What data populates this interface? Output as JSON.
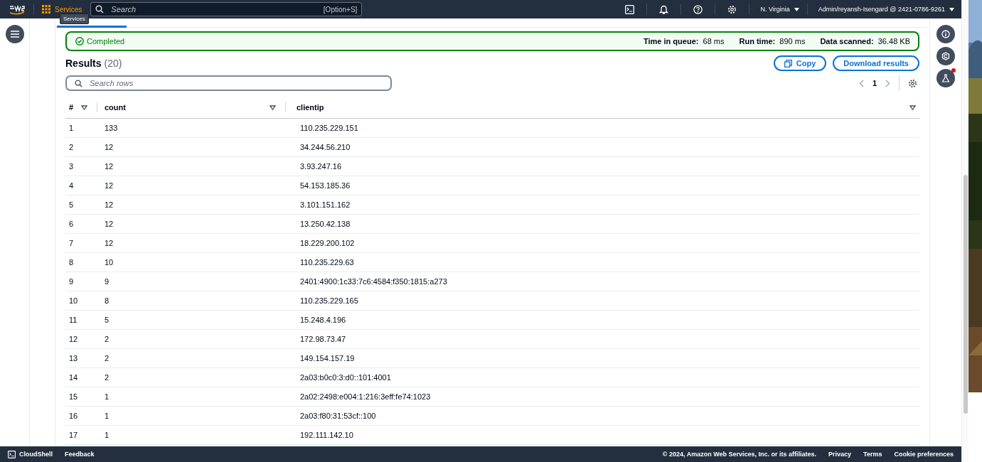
{
  "top_nav": {
    "services_label": "Services",
    "search_placeholder": "Search",
    "search_shortcut": "[Option+S]",
    "region": "N. Virginia",
    "account": "Admin/reyansh-Isengard @ 2421-0786-9261",
    "tooltip": "Services"
  },
  "status": {
    "label": "Completed",
    "metrics": [
      {
        "label": "Time in queue:",
        "value": "68 ms"
      },
      {
        "label": "Run time:",
        "value": "890 ms"
      },
      {
        "label": "Data scanned:",
        "value": "36.48 KB"
      }
    ]
  },
  "results": {
    "title": "Results",
    "count": "(20)",
    "copy_button": "Copy",
    "download_button": "Download results",
    "search_placeholder": "Search rows",
    "page": "1"
  },
  "table": {
    "columns": [
      "#",
      "count",
      "clientip"
    ],
    "rows": [
      [
        "1",
        "133",
        "110.235.229.151"
      ],
      [
        "2",
        "12",
        "34.244.56.210"
      ],
      [
        "3",
        "12",
        "3.93.247.16"
      ],
      [
        "4",
        "12",
        "54.153.185.36"
      ],
      [
        "5",
        "12",
        "3.101.151.162"
      ],
      [
        "6",
        "12",
        "13.250.42.138"
      ],
      [
        "7",
        "12",
        "18.229.200.102"
      ],
      [
        "8",
        "10",
        "110.235.229.63"
      ],
      [
        "9",
        "9",
        "2401:4900:1c33:7c6:4584:f350:1815:a273"
      ],
      [
        "10",
        "8",
        "110.235.229.165"
      ],
      [
        "11",
        "5",
        "15.248.4.196"
      ],
      [
        "12",
        "2",
        "172.98.73.47"
      ],
      [
        "13",
        "2",
        "149.154.157.19"
      ],
      [
        "14",
        "2",
        "2a03:b0c0:3:d0::101:4001"
      ],
      [
        "15",
        "1",
        "2a02:2498:e004:1:216:3eff:fe74:1023"
      ],
      [
        "16",
        "1",
        "2a03:f80:31:53cf::100"
      ],
      [
        "17",
        "1",
        "192.111.142.10"
      ]
    ]
  },
  "right_rail": [
    {
      "kind": "info",
      "badge": false
    },
    {
      "kind": "refresh",
      "badge": false
    },
    {
      "kind": "flask",
      "badge": true
    }
  ],
  "footer": {
    "cloudshell": "CloudShell",
    "feedback": "Feedback",
    "copyright": "© 2024, Amazon Web Services, Inc. or its affiliates.",
    "links": [
      "Privacy",
      "Terms",
      "Cookie preferences"
    ]
  }
}
